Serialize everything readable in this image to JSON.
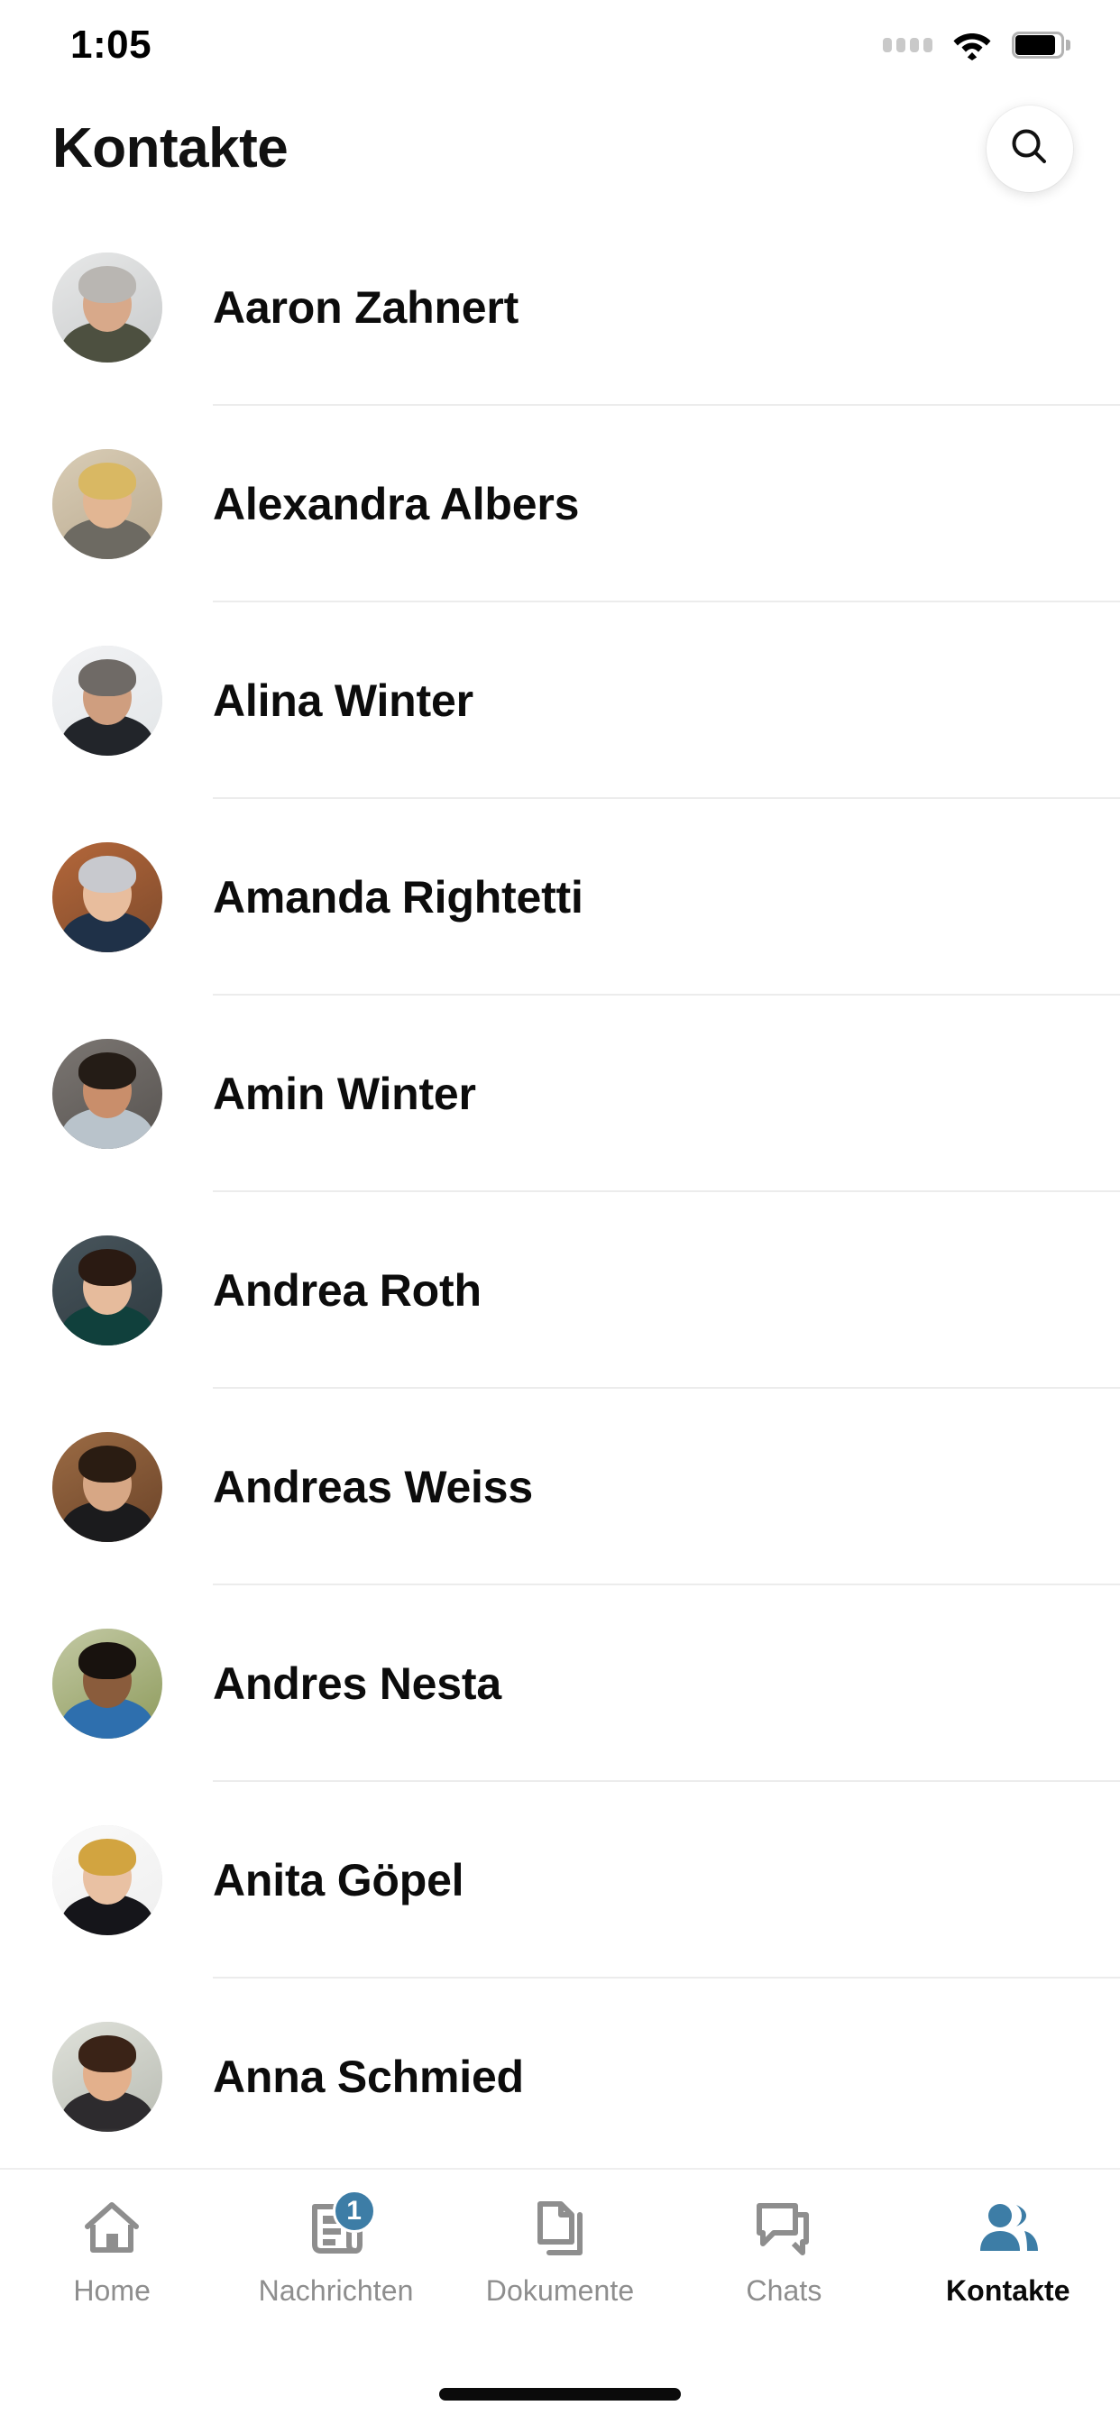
{
  "status_bar": {
    "time": "1:05",
    "signal_icon": "signal-dots-icon",
    "wifi_icon": "wifi-icon",
    "battery_icon": "battery-full-icon"
  },
  "header": {
    "title": "Kontakte",
    "search_icon": "search-icon"
  },
  "contacts": [
    {
      "name": "Aaron Zahnert",
      "avatar": {
        "bg": "#c8cacb",
        "bg2": "#e7e8e8",
        "skin": "#d8a98a",
        "hair": "#b9b6b2",
        "shirt": "#4d5040"
      }
    },
    {
      "name": "Alexandra Albers",
      "avatar": {
        "bg": "#b9a98f",
        "bg2": "#d9cdb6",
        "skin": "#e2b693",
        "hair": "#d9b863",
        "shirt": "#6d6a62"
      }
    },
    {
      "name": "Alina Winter",
      "avatar": {
        "bg": "#e3e6e8",
        "bg2": "#f2f3f5",
        "skin": "#cf9e7f",
        "hair": "#6f6a66",
        "shirt": "#22252a"
      }
    },
    {
      "name": "Amanda Rightetti",
      "avatar": {
        "bg": "#7d4a2c",
        "bg2": "#b4673a",
        "skin": "#e8bd9d",
        "hair": "#c8c9ce",
        "shirt": "#1f3148"
      }
    },
    {
      "name": "Amin Winter",
      "avatar": {
        "bg": "#575350",
        "bg2": "#7b7672",
        "skin": "#c98e6b",
        "hair": "#241c16",
        "shirt": "#b9c3cb"
      }
    },
    {
      "name": "Andrea Roth",
      "avatar": {
        "bg": "#2f3a40",
        "bg2": "#48555c",
        "skin": "#e6bb9c",
        "hair": "#2a1a12",
        "shirt": "#10403c"
      }
    },
    {
      "name": "Andreas Weiss",
      "avatar": {
        "bg": "#6b4328",
        "bg2": "#9b6b44",
        "skin": "#d7a785",
        "hair": "#2a1c12",
        "shirt": "#1b1b1d"
      }
    },
    {
      "name": "Andres Nesta",
      "avatar": {
        "bg": "#8d9a5b",
        "bg2": "#c3c9a4",
        "skin": "#8a5c3c",
        "hair": "#18120e",
        "shirt": "#2e6fae"
      }
    },
    {
      "name": "Anita Göpel",
      "avatar": {
        "bg": "#efefef",
        "bg2": "#fafafa",
        "skin": "#e9c1a3",
        "hair": "#d2a440",
        "shirt": "#15151a"
      }
    },
    {
      "name": "Anna Schmied",
      "avatar": {
        "bg": "#b9bcb3",
        "bg2": "#dfe1da",
        "skin": "#e3b08c",
        "hair": "#3a2317",
        "shirt": "#2d2b2e"
      }
    }
  ],
  "tabs": [
    {
      "label": "Home",
      "icon": "home-icon",
      "active": false,
      "badge": ""
    },
    {
      "label": "Nachrichten",
      "icon": "news-icon",
      "active": false,
      "badge": "1"
    },
    {
      "label": "Dokumente",
      "icon": "documents-icon",
      "active": false,
      "badge": ""
    },
    {
      "label": "Chats",
      "icon": "chat-icon",
      "active": false,
      "badge": ""
    },
    {
      "label": "Kontakte",
      "icon": "contacts-icon",
      "active": true,
      "badge": ""
    }
  ],
  "colors": {
    "accent": "#3d7da6",
    "inactive_icon": "#8e8e8e",
    "divider": "#ececec",
    "text_primary": "#0c0c0c"
  }
}
